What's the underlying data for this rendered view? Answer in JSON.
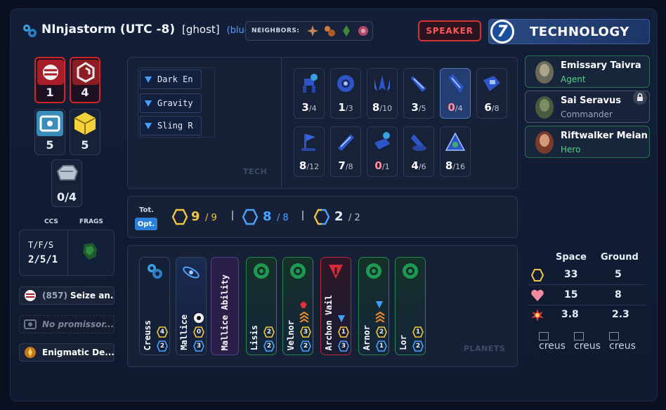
{
  "header": {
    "player_name": "NInjastorm (UTC -8)",
    "ghost_tag": "[ghost]",
    "color_tag": "(blue)",
    "neighbors_label": "NEIGHBORS:",
    "speaker_label": "SPEAKER",
    "strategy_number": "7",
    "strategy_name": "TECHNOLOGY",
    "accent": "#4aa3ff"
  },
  "tokens": {
    "command_a": "1",
    "command_b": "4",
    "fleet_a": "5",
    "fleet_b": "5",
    "commodities": "0/4"
  },
  "ccs": {
    "ccs_label": "CCS",
    "frags_label": "FRAGS",
    "tfs_label": "T/F/S",
    "tfs_value": "2/5/1"
  },
  "left_items": {
    "seize_prefix": "(857)",
    "seize_label": "Seize an...",
    "promissory_placeholder": "No promissor...",
    "relic_label": "Enigmatic De..."
  },
  "techs": [
    "Dark En",
    "Gravity",
    "Sling R"
  ],
  "tech_watermark": "TECH",
  "units_row1": [
    {
      "n": "3",
      "of": "/4"
    },
    {
      "n": "1",
      "of": "/3"
    },
    {
      "n": "8",
      "of": "/10"
    },
    {
      "n": "3",
      "of": "/5"
    },
    {
      "n": "0",
      "of": "/4"
    },
    {
      "n": "6",
      "of": "/8"
    }
  ],
  "units_row2": [
    {
      "n": "8",
      "of": "/12"
    },
    {
      "n": "7",
      "of": "/8"
    },
    {
      "n": "0",
      "of": "/1"
    },
    {
      "n": "4",
      "of": "/6"
    },
    {
      "n": "8",
      "of": "/16"
    }
  ],
  "totals": {
    "tot_label": "Tot.",
    "opt_label": "Opt.",
    "res_current": "9",
    "res_total": "/ 9",
    "inf_current": "8",
    "inf_total": "/ 8",
    "flex_current": "2",
    "flex_total": "/ 2",
    "res_color": "#f4c542",
    "inf_color": "#4aa3ff"
  },
  "planets": [
    {
      "name": "Creuss",
      "res": "4",
      "inf": "2"
    },
    {
      "name": "Mallice",
      "res": "0",
      "inf": "3"
    },
    {
      "name": "Mallice Ability"
    },
    {
      "name": "Lisis",
      "res": "2",
      "inf": "2"
    },
    {
      "name": "Velnor",
      "res": "3",
      "inf": "2"
    },
    {
      "name": "Archon Vail",
      "res": "1",
      "inf": "3"
    },
    {
      "name": "Arnor",
      "res": "2",
      "inf": "1"
    },
    {
      "name": "Lor",
      "res": "1",
      "inf": "2"
    }
  ],
  "planets_watermark": "PLANETS",
  "leaders": [
    {
      "name": "Emissary Taivra",
      "role": "Agent"
    },
    {
      "name": "Sai Seravus",
      "role": "Commander"
    },
    {
      "name": "Riftwalker Meian",
      "role": "Hero"
    }
  ],
  "stats": {
    "space_label": "Space",
    "ground_label": "Ground",
    "rows": [
      {
        "space": "33",
        "ground": "5"
      },
      {
        "space": "15",
        "ground": "8"
      },
      {
        "space": "3.8",
        "ground": "2.3"
      }
    ]
  },
  "broken_images": [
    "creus",
    "creus",
    "creus"
  ]
}
